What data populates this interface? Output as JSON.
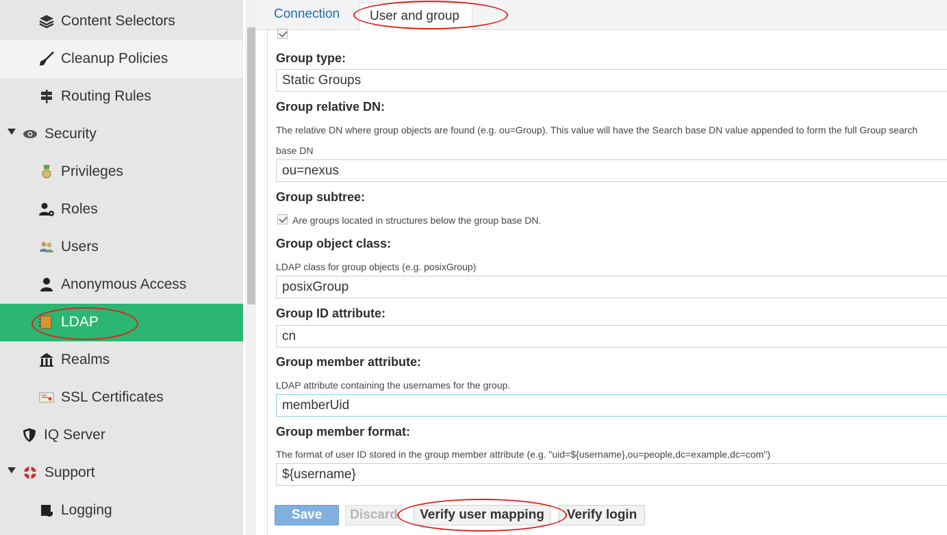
{
  "sidebar": {
    "items": [
      {
        "label": "Content Selectors",
        "icon": "layers-icon"
      },
      {
        "label": "Cleanup Policies",
        "icon": "broom-icon"
      },
      {
        "label": "Routing Rules",
        "icon": "signpost-icon"
      },
      {
        "label": "Security",
        "icon": "eye-icon"
      },
      {
        "label": "Privileges",
        "icon": "medal-icon"
      },
      {
        "label": "Roles",
        "icon": "user-gear-icon"
      },
      {
        "label": "Users",
        "icon": "users-icon"
      },
      {
        "label": "Anonymous Access",
        "icon": "user-icon"
      },
      {
        "label": "LDAP",
        "icon": "address-book-icon"
      },
      {
        "label": "Realms",
        "icon": "building-icon"
      },
      {
        "label": "SSL Certificates",
        "icon": "certificate-icon"
      },
      {
        "label": "IQ Server",
        "icon": "shield-icon"
      },
      {
        "label": "Support",
        "icon": "lifebuoy-icon"
      },
      {
        "label": "Logging",
        "icon": "scroll-icon"
      }
    ]
  },
  "tabs": {
    "connection": "Connection",
    "user_and_group": "User and group"
  },
  "form": {
    "group_type": {
      "label": "Group type:",
      "value": "Static Groups"
    },
    "group_relative_dn": {
      "label": "Group relative DN:",
      "help": "The relative DN where group objects are found (e.g. ou=Group). This value will have the Search base DN value appended to form the full Group search",
      "help2": "base DN",
      "value": "ou=nexus"
    },
    "group_subtree": {
      "label": "Group subtree:",
      "checkbox_label": "Are groups located in structures below the group base DN."
    },
    "group_object_class": {
      "label": "Group object class:",
      "help": "LDAP class for group objects (e.g. posixGroup)",
      "value": "posixGroup"
    },
    "group_id_attribute": {
      "label": "Group ID attribute:",
      "value": "cn"
    },
    "group_member_attribute": {
      "label": "Group member attribute:",
      "help": "LDAP attribute containing the usernames for the group.",
      "value": "memberUid"
    },
    "group_member_format": {
      "label": "Group member format:",
      "help": "The format of user ID stored in the group member attribute (e.g. \"uid=${username},ou=people,dc=example,dc=com\")",
      "value": "${username}"
    }
  },
  "buttons": {
    "save": "Save",
    "discard": "Discard",
    "verify_user_mapping": "Verify user mapping",
    "verify_login": "Verify login"
  },
  "colors": {
    "active_nav": "#2bb673",
    "annotation": "#e0201c",
    "link": "#1a6cb5",
    "save_button": "#7fb0e0"
  }
}
